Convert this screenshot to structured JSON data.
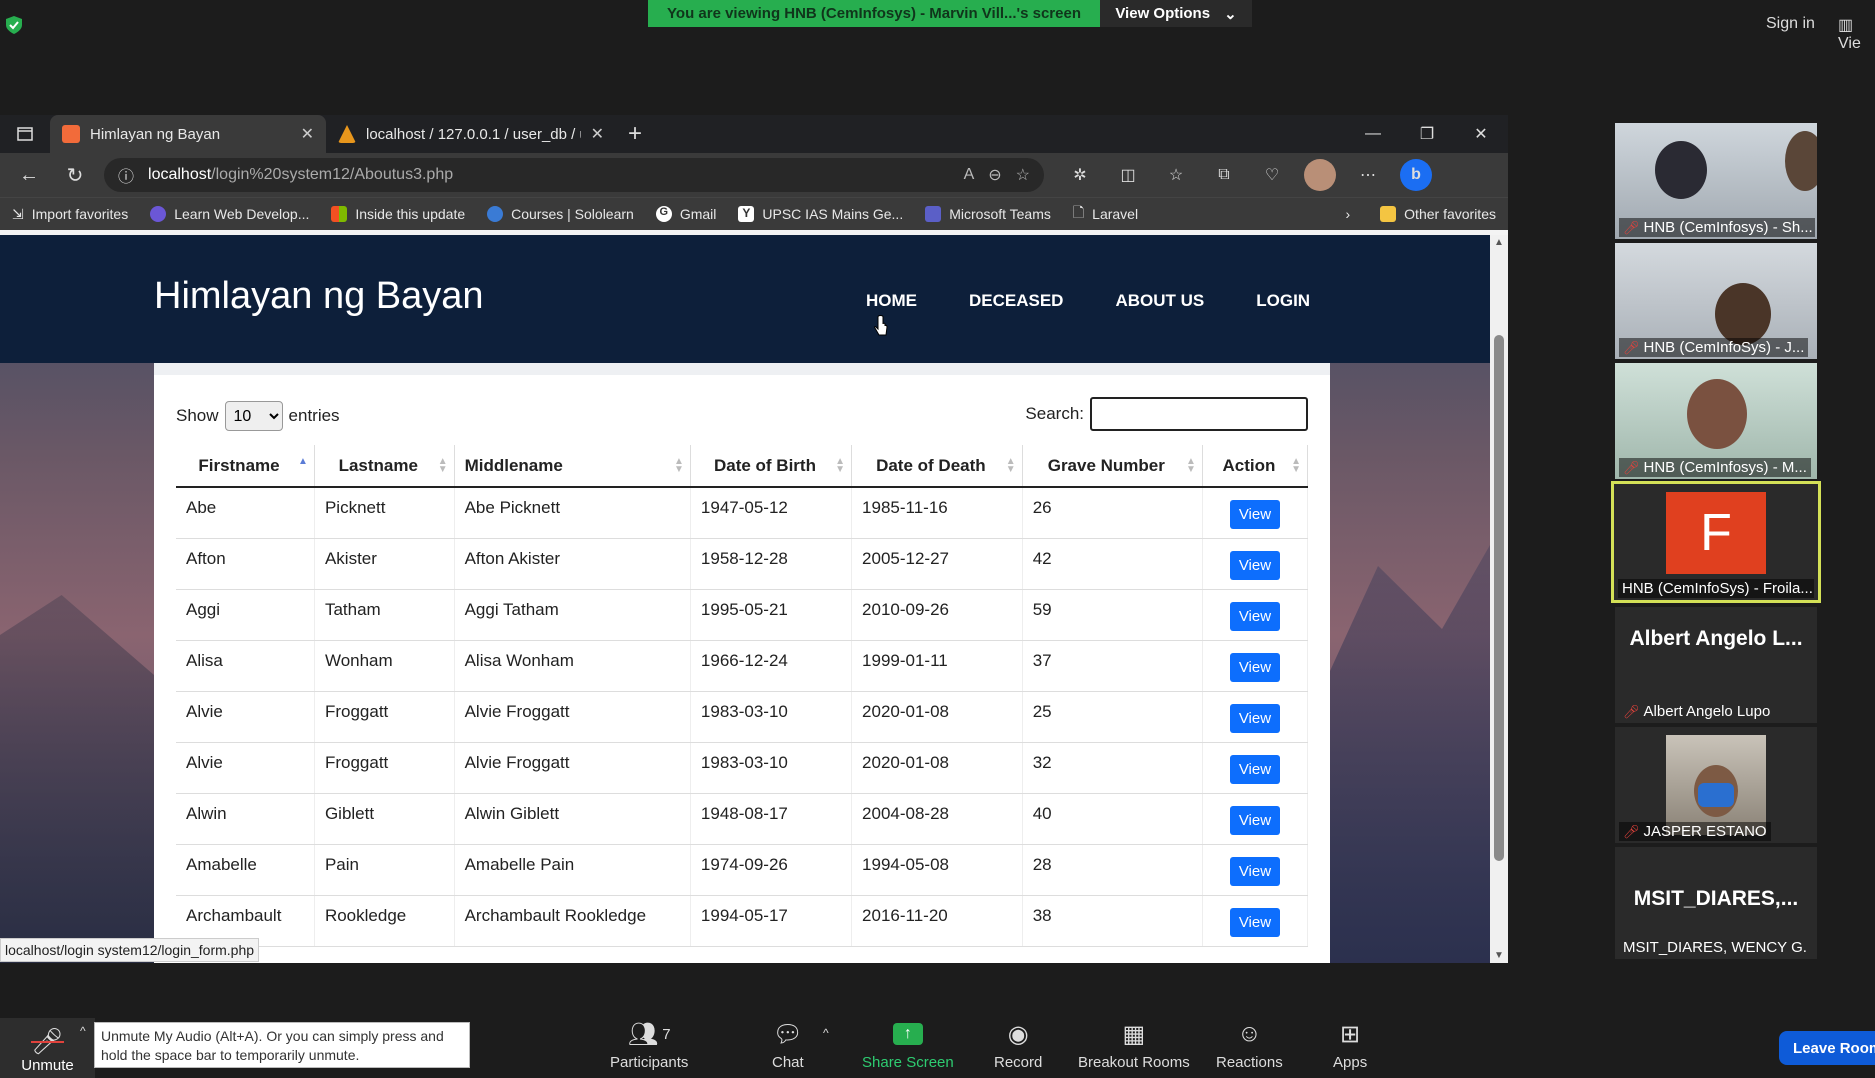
{
  "zoom": {
    "share_banner": "You are viewing HNB (CemInfosys) - Marvin Vill...'s screen",
    "view_options": "View Options",
    "sign_in": "Sign in",
    "view_right": "Vie"
  },
  "browser": {
    "tabs": [
      {
        "label": "Himlayan ng Bayan"
      },
      {
        "label": "localhost / 127.0.0.1 / user_db / u"
      }
    ],
    "url_host": "localhost",
    "url_path": "/login%20system12/Aboutus3.php",
    "favorites": [
      "Import favorites",
      "Learn Web Develop...",
      "Inside this update",
      "Courses | Sololearn",
      "Gmail",
      "UPSC IAS Mains Ge...",
      "Microsoft Teams",
      "Laravel"
    ],
    "other_favorites": "Other favorites",
    "status_link": "localhost/login system12/login_form.php"
  },
  "site": {
    "title": "Himlayan ng Bayan",
    "nav": [
      "HOME",
      "DECEASED",
      "ABOUT US",
      "LOGIN"
    ],
    "show_label": "Show",
    "entries_value": "10",
    "entries_label": "entries",
    "search_label": "Search:",
    "columns": [
      "Firstname",
      "Lastname",
      "Middlename",
      "Date of Birth",
      "Date of Death",
      "Grave Number",
      "Action"
    ],
    "rows": [
      [
        "Abe",
        "Picknett",
        "Abe Picknett",
        "1947-05-12",
        "1985-11-16",
        "26"
      ],
      [
        "Afton",
        "Akister",
        "Afton Akister",
        "1958-12-28",
        "2005-12-27",
        "42"
      ],
      [
        "Aggi",
        "Tatham",
        "Aggi Tatham",
        "1995-05-21",
        "2010-09-26",
        "59"
      ],
      [
        "Alisa",
        "Wonham",
        "Alisa Wonham",
        "1966-12-24",
        "1999-01-11",
        "37"
      ],
      [
        "Alvie",
        "Froggatt",
        "Alvie Froggatt",
        "1983-03-10",
        "2020-01-08",
        "25"
      ],
      [
        "Alvie",
        "Froggatt",
        "Alvie Froggatt",
        "1983-03-10",
        "2020-01-08",
        "32"
      ],
      [
        "Alwin",
        "Giblett",
        "Alwin Giblett",
        "1948-08-17",
        "2004-08-28",
        "40"
      ],
      [
        "Amabelle",
        "Pain",
        "Amabelle Pain",
        "1974-09-26",
        "1994-05-08",
        "28"
      ],
      [
        "Archambault",
        "Rookledge",
        "Archambault Rookledge",
        "1994-05-17",
        "2016-11-20",
        "38"
      ]
    ],
    "view_label": "View"
  },
  "participants": [
    {
      "name": "HNB (CemInfosys) - Sh..."
    },
    {
      "name": "HNB (CemInfoSys) - J..."
    },
    {
      "name": "HNB (CemInfosys) - M..."
    },
    {
      "name": "HNB (CemInfoSys) - Froila...",
      "initial": "F"
    },
    {
      "name": "Albert Angelo Lupo",
      "big": "Albert Angelo L..."
    },
    {
      "name": "JASPER ESTANO"
    },
    {
      "name": "MSIT_DIARES, WENCY G.",
      "big": "MSIT_DIARES,..."
    }
  ],
  "toolbar": {
    "unmute": "Unmute",
    "tooltip": "Unmute My Audio (Alt+A). Or you can simply press and hold the space bar to temporarily unmute.",
    "participants": "Participants",
    "participants_count": "7",
    "chat": "Chat",
    "share": "Share Screen",
    "record": "Record",
    "breakout": "Breakout Rooms",
    "reactions": "Reactions",
    "apps": "Apps",
    "leave": "Leave Room"
  }
}
